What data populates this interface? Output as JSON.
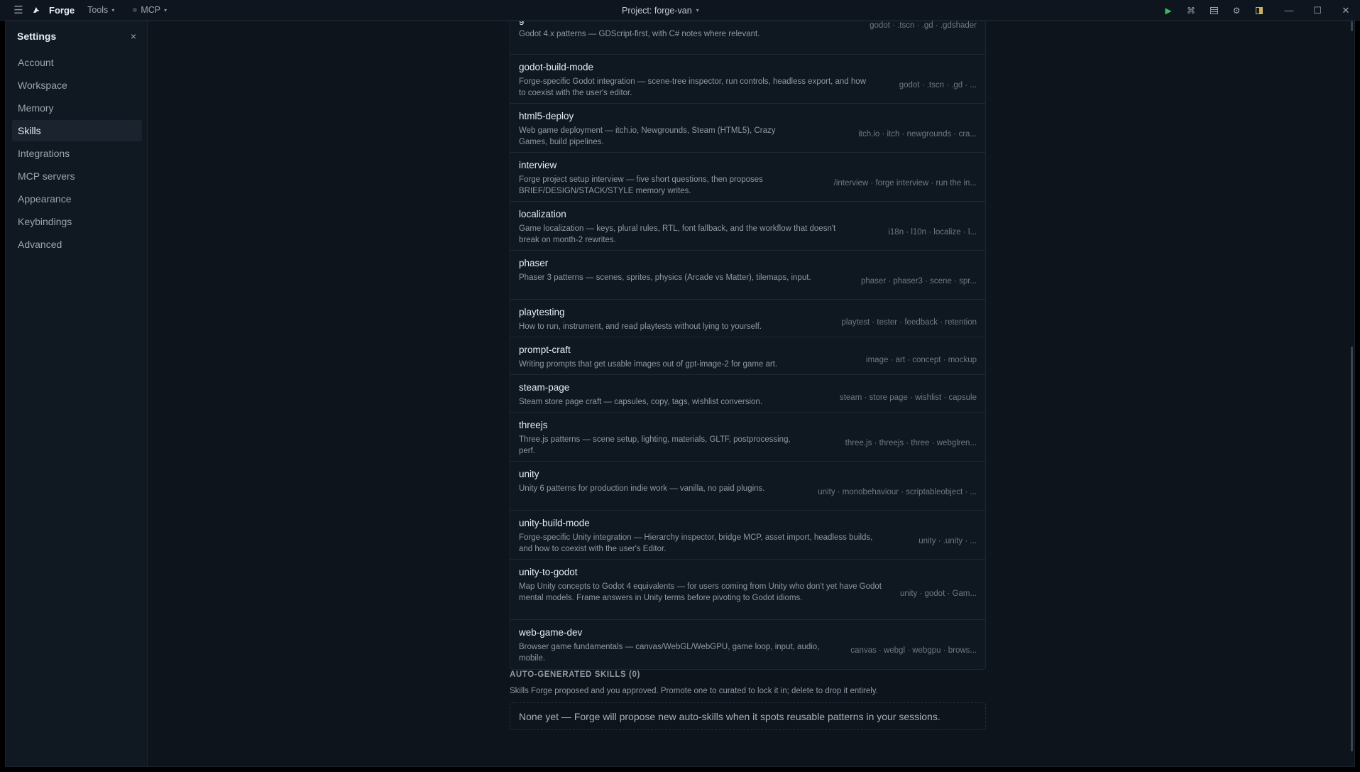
{
  "titlebar": {
    "app_name": "Forge",
    "tools_menu": "Tools",
    "mcp_menu": "MCP",
    "project": "Project: forge-van",
    "icons": [
      "hamburger-icon",
      "play-icon",
      "command-icon",
      "panels-icon",
      "gear-icon",
      "sidebar-toggle-icon",
      "minimize-icon",
      "maximize-icon",
      "close-icon"
    ]
  },
  "sidebar": {
    "title": "Settings",
    "close": "×",
    "items": [
      {
        "label": "Account"
      },
      {
        "label": "Workspace"
      },
      {
        "label": "Memory"
      },
      {
        "label": "Skills",
        "active": true
      },
      {
        "label": "Integrations"
      },
      {
        "label": "MCP servers"
      },
      {
        "label": "Appearance"
      },
      {
        "label": "Keybindings"
      },
      {
        "label": "Advanced"
      }
    ]
  },
  "skills": [
    {
      "name": "g",
      "desc": "Godot 4.x patterns — GDScript-first, with C# notes where relevant.",
      "tags": "godot · .tscn · .gd · .gdshader"
    },
    {
      "name": "godot-build-mode",
      "desc": "Forge-specific Godot integration — scene-tree inspector, run controls, headless export, and how to coexist with the user's editor.",
      "tags": "godot · .tscn · .gd · ..."
    },
    {
      "name": "html5-deploy",
      "desc": "Web game deployment — itch.io, Newgrounds, Steam (HTML5), Crazy Games, build pipelines.",
      "tags": "itch.io · itch · newgrounds · cra..."
    },
    {
      "name": "interview",
      "desc": "Forge project setup interview — five short questions, then proposes BRIEF/DESIGN/STACK/STYLE memory writes.",
      "tags": "/interview · forge interview · run the in..."
    },
    {
      "name": "localization",
      "desc": "Game localization — keys, plural rules, RTL, font fallback, and the workflow that doesn't break on month-2 rewrites.",
      "tags": "i18n · l10n · localize · l..."
    },
    {
      "name": "phaser",
      "desc": "Phaser 3 patterns — scenes, sprites, physics (Arcade vs Matter), tilemaps, input.",
      "tags": "phaser · phaser3 · scene · spr..."
    },
    {
      "name": "playtesting",
      "desc": "How to run, instrument, and read playtests without lying to yourself.",
      "tags": "playtest · tester · feedback · retention"
    },
    {
      "name": "prompt-craft",
      "desc": "Writing prompts that get usable images out of gpt-image-2 for game art.",
      "tags": "image · art · concept · mockup"
    },
    {
      "name": "steam-page",
      "desc": "Steam store page craft — capsules, copy, tags, wishlist conversion.",
      "tags": "steam · store page · wishlist · capsule"
    },
    {
      "name": "threejs",
      "desc": "Three.js patterns — scene setup, lighting, materials, GLTF, postprocessing, perf.",
      "tags": "three.js · threejs · three · webglren..."
    },
    {
      "name": "unity",
      "desc": "Unity 6 patterns for production indie work — vanilla, no paid plugins.",
      "tags": "unity · monobehaviour · scriptableobject · ..."
    },
    {
      "name": "unity-build-mode",
      "desc": "Forge-specific Unity integration — Hierarchy inspector, bridge MCP, asset import, headless builds, and how to coexist with the user's Editor.",
      "tags": "unity · .unity · ..."
    },
    {
      "name": "unity-to-godot",
      "desc": "Map Unity concepts to Godot 4 equivalents — for users coming from Unity who don't yet have Godot mental models. Frame answers in Unity terms before pivoting to Godot idioms.",
      "tags": "unity · godot · Gam..."
    },
    {
      "name": "web-game-dev",
      "desc": "Browser game fundamentals — canvas/WebGL/WebGPU, game loop, input, audio, mobile.",
      "tags": "canvas · webgl · webgpu · brows..."
    }
  ],
  "auto_skills": {
    "title": "AUTO-GENERATED SKILLS (0)",
    "desc": "Skills Forge proposed and you approved. Promote one to curated to lock it in; delete to drop it entirely.",
    "empty": "None yet — Forge will propose new auto-skills when it spots reusable patterns in your sessions."
  }
}
